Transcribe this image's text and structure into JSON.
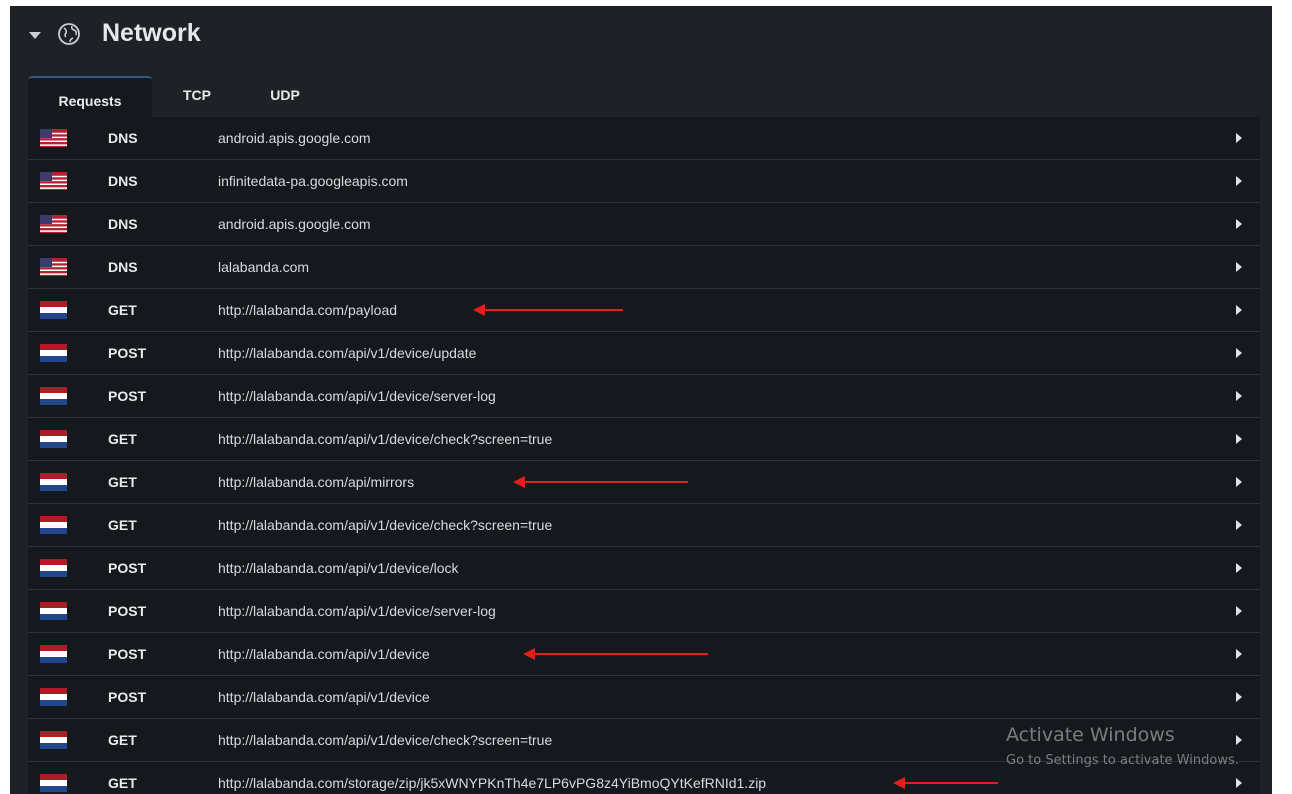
{
  "header": {
    "title": "Network",
    "icon": "globe-icon"
  },
  "tabs": [
    {
      "label": "Requests",
      "active": true
    },
    {
      "label": "TCP",
      "active": false
    },
    {
      "label": "UDP",
      "active": false
    }
  ],
  "requests": [
    {
      "flag": "us",
      "method": "DNS",
      "url": "android.apis.google.com",
      "annotated": false
    },
    {
      "flag": "us",
      "method": "DNS",
      "url": "infinitedata-pa.googleapis.com",
      "annotated": false
    },
    {
      "flag": "us",
      "method": "DNS",
      "url": "android.apis.google.com",
      "annotated": false
    },
    {
      "flag": "us",
      "method": "DNS",
      "url": "lalabanda.com",
      "annotated": false
    },
    {
      "flag": "nl",
      "method": "GET",
      "url": "http://lalabanda.com/payload",
      "annotated": true
    },
    {
      "flag": "nl",
      "method": "POST",
      "url": "http://lalabanda.com/api/v1/device/update",
      "annotated": false
    },
    {
      "flag": "nl",
      "method": "POST",
      "url": "http://lalabanda.com/api/v1/device/server-log",
      "annotated": false
    },
    {
      "flag": "nl",
      "method": "GET",
      "url": "http://lalabanda.com/api/v1/device/check?screen=true",
      "annotated": false
    },
    {
      "flag": "nl",
      "method": "GET",
      "url": "http://lalabanda.com/api/mirrors",
      "annotated": true
    },
    {
      "flag": "nl",
      "method": "GET",
      "url": "http://lalabanda.com/api/v1/device/check?screen=true",
      "annotated": false
    },
    {
      "flag": "nl",
      "method": "POST",
      "url": "http://lalabanda.com/api/v1/device/lock",
      "annotated": false
    },
    {
      "flag": "nl",
      "method": "POST",
      "url": "http://lalabanda.com/api/v1/device/server-log",
      "annotated": false
    },
    {
      "flag": "nl",
      "method": "POST",
      "url": "http://lalabanda.com/api/v1/device",
      "annotated": true
    },
    {
      "flag": "nl",
      "method": "POST",
      "url": "http://lalabanda.com/api/v1/device",
      "annotated": false
    },
    {
      "flag": "nl",
      "method": "GET",
      "url": "http://lalabanda.com/api/v1/device/check?screen=true",
      "annotated": false
    },
    {
      "flag": "nl",
      "method": "GET",
      "url": "http://lalabanda.com/storage/zip/jk5xWNYPKnTh4e7LP6vPG8z4YiBmoQYtKefRNId1.zip",
      "annotated": true
    }
  ],
  "watermark": {
    "title": "Activate Windows",
    "subtitle": "Go to Settings to activate Windows."
  },
  "colors": {
    "panel": "#1e2226",
    "list": "#15191d",
    "accent": "#2f5a86",
    "annotation": "#e0201a"
  }
}
